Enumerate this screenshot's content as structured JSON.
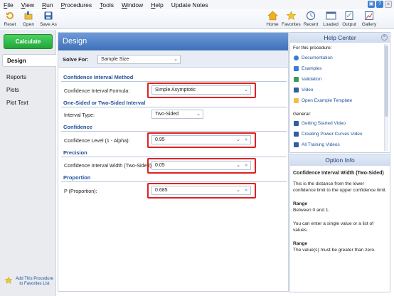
{
  "menu": [
    {
      "label": "File",
      "ul": "F",
      "rest": "ile"
    },
    {
      "label": "View",
      "ul": "V",
      "rest": "iew"
    },
    {
      "label": "Run",
      "ul": "R",
      "rest": "un"
    },
    {
      "label": "Procedures",
      "ul": "P",
      "rest": "rocedures"
    },
    {
      "label": "Tools",
      "ul": "T",
      "rest": "ools"
    },
    {
      "label": "Window",
      "ul": "W",
      "rest": "indow"
    },
    {
      "label": "Help",
      "ul": "H",
      "rest": "elp"
    },
    {
      "label": "Update Notes",
      "ul": "",
      "rest": "Update Notes"
    }
  ],
  "toolbar": {
    "reset": "Reset",
    "open": "Open",
    "save_as": "Save As",
    "home": "Home",
    "favorites": "Favorites",
    "recent": "Recent",
    "loaded": "Loaded",
    "output": "Output",
    "gallery": "Gallery"
  },
  "left": {
    "calculate": "Calculate",
    "nav": [
      "Design",
      "Reports",
      "Plots",
      "Plot Text"
    ],
    "favorites": "Add This Procedure to Favorites List"
  },
  "design": {
    "title": "Design",
    "solve_for_label": "Solve For:",
    "solve_for_value": "Sample Size",
    "sections": {
      "ci_method": "Confidence Interval Method",
      "sided": "One-Sided or Two-Sided Interval",
      "confidence": "Confidence",
      "precision": "Precision",
      "proportion": "Proportion"
    },
    "fields": {
      "ci_formula_label": "Confidence Interval Formula:",
      "ci_formula_value": "Simple Asymptotic",
      "interval_type_label": "Interval Type:",
      "interval_type_value": "Two-Sided",
      "conf_level_label": "Confidence Level (1 - Alpha):",
      "conf_level_value": "0.95",
      "ci_width_label": "Confidence Interval Width (Two-Sided):",
      "ci_width_value": "0.05",
      "p_label": "P (Proportion):",
      "p_value": "0.685"
    }
  },
  "help": {
    "title": "Help Center",
    "for_this": "For this procedure:",
    "items": [
      "Documentation",
      "Examples",
      "Validation",
      "Video",
      "Open Example Template"
    ],
    "general": "General:",
    "general_items": [
      "Getting Started Video",
      "Creating Power Curves Video",
      "All Training Videos"
    ]
  },
  "option_info": {
    "title": "Option Info",
    "heading": "Confidence Interval Width (Two-Sided)",
    "desc": "This is the distance from the lower confidence limit to the upper confidence limit.",
    "range_title": "Range",
    "range_text": "Between 0 and 1.",
    "list_text": "You can enter a single value or a list of values.",
    "range2_title": "Range",
    "range2_text": "The value(s) must be greater than zero."
  },
  "colors": {
    "accent": "#3e6fb8",
    "section": "#1f4f9a",
    "highlight": "#e02020",
    "calculate": "#22a63a"
  }
}
